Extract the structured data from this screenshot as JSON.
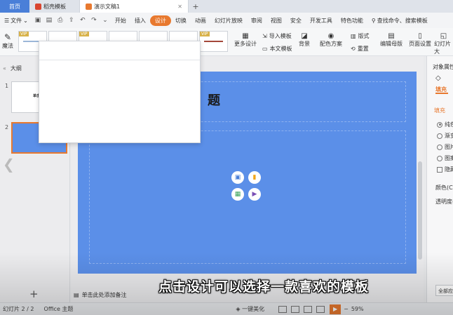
{
  "tabs": {
    "home": "首页",
    "templates": "稻壳模板",
    "document": "演示文稿1"
  },
  "menu": {
    "file": "文件",
    "items": [
      "开始",
      "插入",
      "设计",
      "切换",
      "动画",
      "幻灯片放映",
      "审阅",
      "视图",
      "安全",
      "开发工具",
      "特色功能"
    ],
    "active_index": 2,
    "search": "查找命令、搜索模板"
  },
  "ribbon": {
    "magic": "魔法",
    "vip": "VIP",
    "more_designs": "更多设计",
    "import_template": "导入模板",
    "this_template": "本文模板",
    "background": "背景",
    "color_scheme": "配色方案",
    "layout": "版式",
    "reset": "重置",
    "edit_master": "编辑母版",
    "page_setup": "页面设置",
    "slide_size": "幻灯片大"
  },
  "left_pane": {
    "outline_tab": "大纲",
    "slide1_num": "1",
    "slide2_num": "2",
    "slide1_title": "单击"
  },
  "slide": {
    "title": "题"
  },
  "notes": "单击此处添加备注",
  "right_pane": {
    "title": "对象属性",
    "tab_fill": "填充",
    "section_fill": "填充",
    "options": [
      "纯色",
      "渐变",
      "图片",
      "图案"
    ],
    "hide": "隐藏",
    "color_label": "颜色(C)",
    "transparency_label": "透明度(",
    "apply_all": "全部应用"
  },
  "status": {
    "slide_count": "幻灯片 2 / 2",
    "theme": "Office 主题",
    "beautify": "一键美化",
    "zoom": "59%"
  },
  "caption": "点击设计可以选择一款喜欢的模板",
  "colors": {
    "accent": "#e8792f",
    "slide_bg": "#5b8fe8",
    "home_tab": "#4a7fd8"
  }
}
